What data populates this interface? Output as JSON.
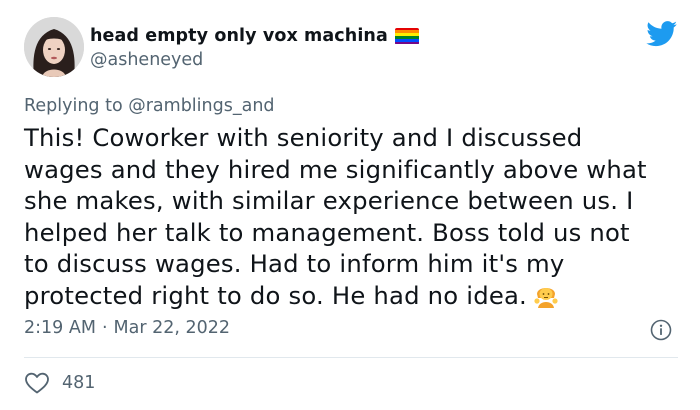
{
  "user": {
    "display_name": "head empty only vox machina",
    "handle": "@asheneyed",
    "avatar_icon": "profile-avatar",
    "badge_icon": "rainbow-flag-emoji"
  },
  "brand_icon": "twitter-bird-icon",
  "colors": {
    "twitter_blue": "#1d9bf0",
    "text_primary": "#0f1419",
    "text_secondary": "#536471",
    "divider": "#e1e8ed"
  },
  "reply": {
    "prefix": "Replying to ",
    "mention": "@ramblings_and"
  },
  "tweet": {
    "lines": [
      "This! Coworker with seniority and I discussed",
      "wages and they hired me significantly above what",
      "she makes, with similar experience between us. I",
      "helped her talk to management. Boss told us not",
      "to discuss wages. Had to inform him it's my",
      "protected right to do so. He had no idea."
    ],
    "emoji": "person-shrugging-emoji"
  },
  "meta": {
    "time": "2:19 AM",
    "separator": "·",
    "date": "Mar 22, 2022",
    "info_icon": "info-icon"
  },
  "engagement": {
    "likes": "481",
    "like_icon": "heart-icon"
  }
}
